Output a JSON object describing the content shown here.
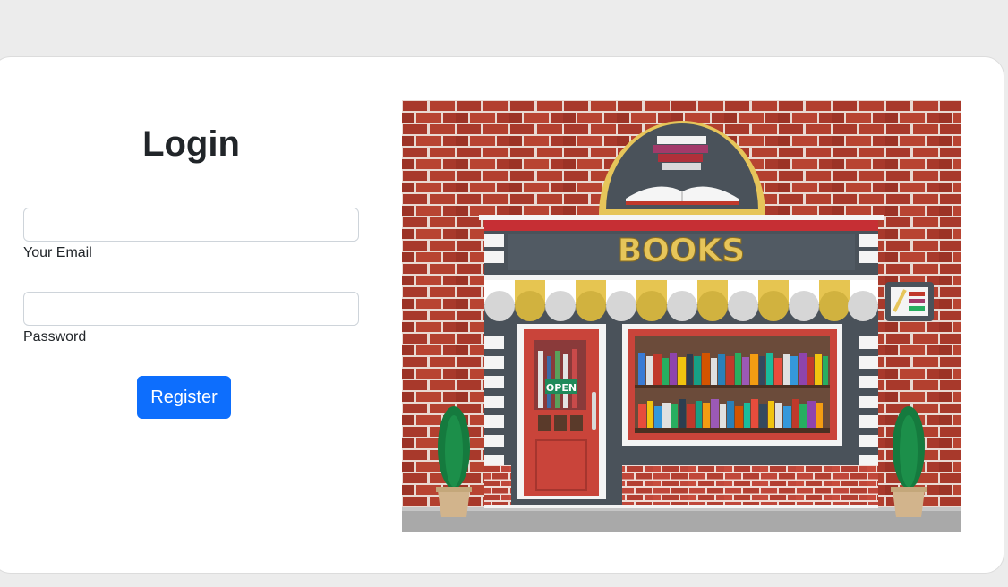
{
  "login": {
    "title": "Login",
    "email_label": "Your Email",
    "email_value": "",
    "password_label": "Password",
    "password_value": "",
    "register_label": "Register"
  },
  "illustration": {
    "sign_text": "BOOKS",
    "door_sign": "OPEN"
  },
  "colors": {
    "primary": "#0d6efd",
    "brick": "#a8392b",
    "awning_yellow": "#e6c551",
    "sign_gold": "#e6c55a"
  }
}
